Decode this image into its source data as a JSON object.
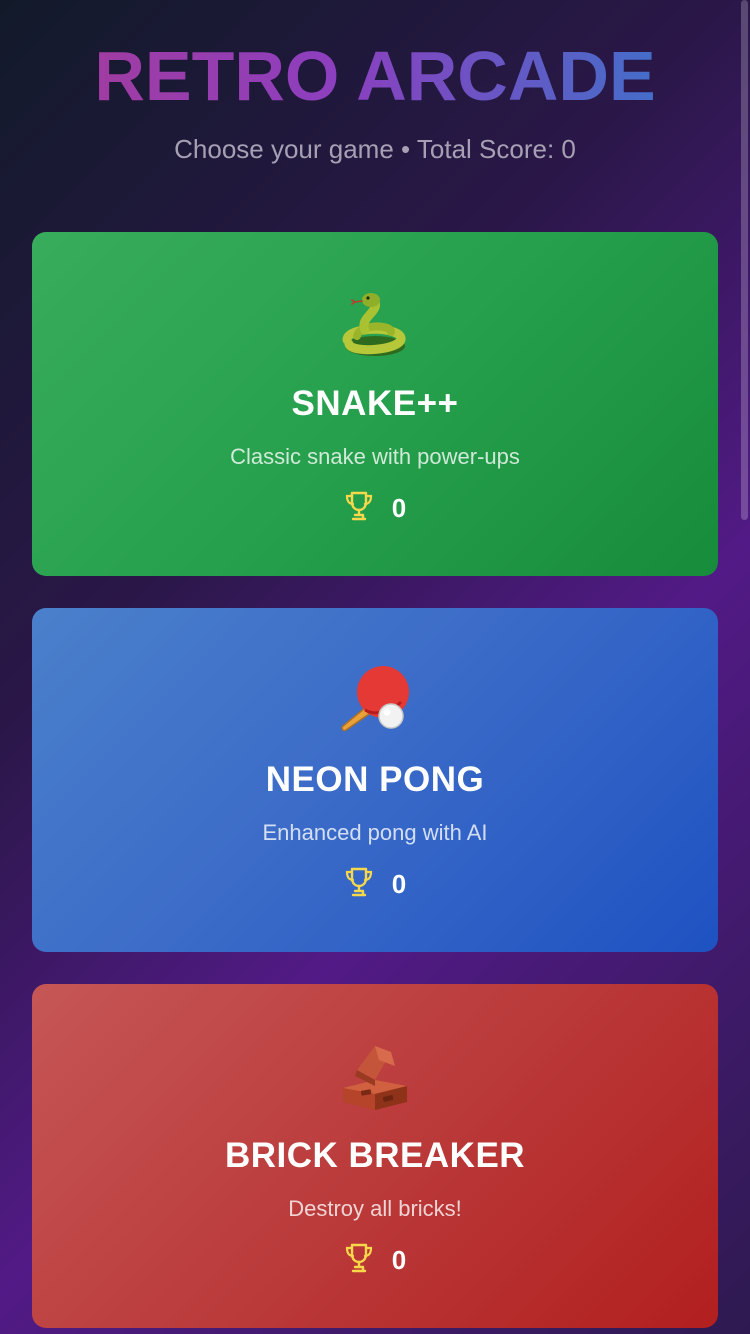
{
  "header": {
    "title": "RETRO ARCADE",
    "subtitle": "Choose your game • Total Score: 0"
  },
  "games": [
    {
      "title": "SNAKE++",
      "description": "Classic snake with power-ups",
      "score": "0",
      "icon": "snake-icon",
      "color": "#26a04d"
    },
    {
      "title": "NEON PONG",
      "description": "Enhanced pong with AI",
      "score": "0",
      "icon": "ping-pong-icon",
      "color": "#3c6cc8"
    },
    {
      "title": "BRICK BREAKER",
      "description": "Destroy all bricks!",
      "score": "0",
      "icon": "brick-icon",
      "color": "#bb3b3b"
    }
  ],
  "colors": {
    "title_gradient_start": "#a83b97",
    "title_gradient_end": "#2f7bcc",
    "trophy": "#f7d84a"
  }
}
